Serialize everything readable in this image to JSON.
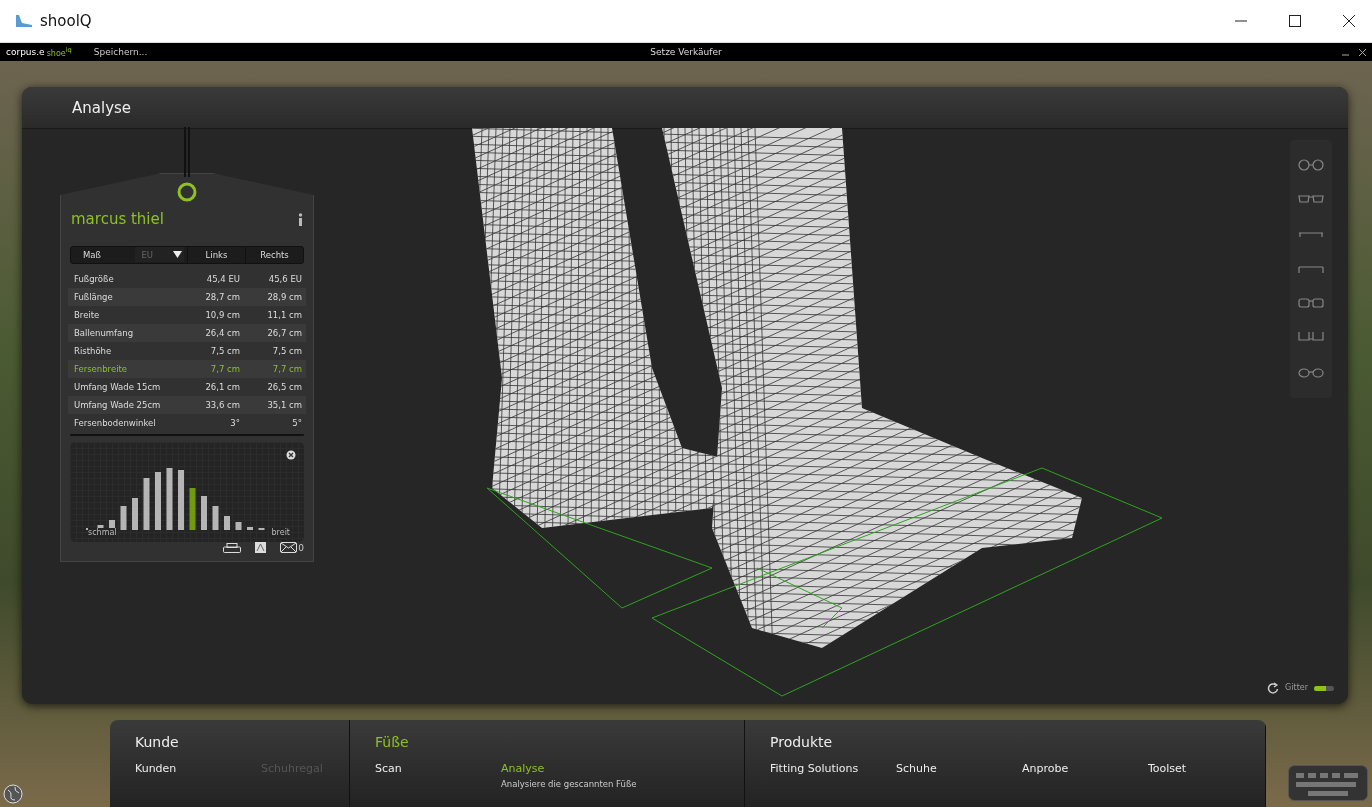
{
  "window": {
    "title": "shoolQ"
  },
  "top_bar": {
    "brand": "corpus.e",
    "brand_suffix": "shoe$^{iq}$",
    "save": "Speichern...",
    "center": "Setze Verkäufer"
  },
  "panel": {
    "title": "Analyse",
    "customer": {
      "name": "marcus thiel"
    },
    "table": {
      "columns": [
        {
          "label": "Maß",
          "kind": "dropdown",
          "value": "EU"
        },
        {
          "label": "Links",
          "kind": "plain"
        },
        {
          "label": "Rechts",
          "kind": "plain"
        }
      ],
      "rows": [
        {
          "label": "Fußgröße",
          "left": "45,4 EU",
          "right": "45,6 EU",
          "selected": false
        },
        {
          "label": "Fußlänge",
          "left": "28,7 cm",
          "right": "28,9 cm",
          "selected": false
        },
        {
          "label": "Breite",
          "left": "10,9 cm",
          "right": "11,1 cm",
          "selected": false
        },
        {
          "label": "Ballenumfang",
          "left": "26,4 cm",
          "right": "26,7 cm",
          "selected": false
        },
        {
          "label": "Risthöhe",
          "left": "7,5 cm",
          "right": "7,5 cm",
          "selected": false
        },
        {
          "label": "Fersenbreite",
          "left": "7,7 cm",
          "right": "7,7 cm",
          "selected": true
        },
        {
          "label": "Umfang Wade 15cm",
          "left": "26,1 cm",
          "right": "26,5 cm",
          "selected": false
        },
        {
          "label": "Umfang Wade 25cm",
          "left": "33,6 cm",
          "right": "35,1 cm",
          "selected": false
        },
        {
          "label": "Fersenbodenwinkel",
          "left": "3°",
          "right": "5°",
          "selected": false
        }
      ]
    },
    "histogram": {
      "left_label": "schmal",
      "right_label": "breit"
    },
    "mail_count": "0",
    "grid_toggle": {
      "label": "Gitter",
      "on": true
    }
  },
  "nav": [
    {
      "title": "Kunde",
      "selected": false,
      "items": [
        {
          "label": "Kunden",
          "selected": false,
          "disabled": false
        },
        {
          "label": "Schuhregal",
          "selected": false,
          "disabled": true
        }
      ]
    },
    {
      "title": "Füße",
      "selected": true,
      "items": [
        {
          "label": "Scan",
          "selected": false,
          "disabled": false
        },
        {
          "label": "Analyse",
          "selected": true,
          "disabled": false,
          "description": "Analysiere die gescannten Füße"
        }
      ]
    },
    {
      "title": "Produkte",
      "selected": false,
      "items": [
        {
          "label": "Fitting Solutions",
          "selected": false,
          "disabled": false
        },
        {
          "label": "Schuhe",
          "selected": false,
          "disabled": false
        },
        {
          "label": "Anprobe",
          "selected": false,
          "disabled": false
        },
        {
          "label": "Toolset",
          "selected": false,
          "disabled": false
        }
      ]
    }
  ]
}
